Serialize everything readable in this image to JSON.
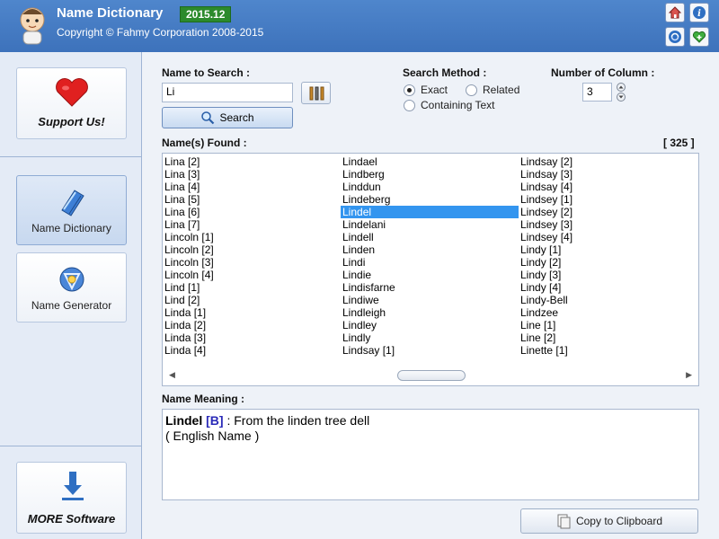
{
  "header": {
    "title": "Name Dictionary",
    "version": "2015.12",
    "copyright": "Copyright © Fahmy Corporation 2008-2015"
  },
  "sidebar": {
    "support_label": "Support Us!",
    "items": [
      {
        "label": "Name Dictionary",
        "active": true
      },
      {
        "label": "Name Generator",
        "active": false
      }
    ],
    "more_label": "MORE Software"
  },
  "search": {
    "label": "Name to Search :",
    "value": "Li",
    "button_label": "Search"
  },
  "method": {
    "label": "Search Method :",
    "options": [
      {
        "label": "Exact",
        "selected": true
      },
      {
        "label": "Related",
        "selected": false
      },
      {
        "label": "Containing Text",
        "selected": false
      }
    ]
  },
  "columns": {
    "label": "Number of Column :",
    "value": "3"
  },
  "results": {
    "label": "Name(s) Found :",
    "count": "[ 325 ]",
    "selected": "Lindel",
    "columns": [
      [
        "Lina [2]",
        "Lina [3]",
        "Lina [4]",
        "Lina [5]",
        "Lina [6]",
        "Lina [7]",
        "Lincoln [1]",
        "Lincoln [2]",
        "Lincoln [3]",
        "Lincoln [4]",
        "Lind [1]",
        "Lind [2]",
        "Linda [1]",
        "Linda [2]",
        "Linda [3]",
        "Linda [4]"
      ],
      [
        "Lindael",
        "Lindberg",
        "Linddun",
        "Lindeberg",
        "Lindel",
        "Lindelani",
        "Lindell",
        "Linden",
        "Lindi",
        "Lindie",
        "Lindisfarne",
        "Lindiwe",
        "Lindleigh",
        "Lindley",
        "Lindly",
        "Lindsay [1]"
      ],
      [
        "Lindsay [2]",
        "Lindsay [3]",
        "Lindsay [4]",
        "Lindsey [1]",
        "Lindsey [2]",
        "Lindsey [3]",
        "Lindsey [4]",
        "Lindy [1]",
        "Lindy [2]",
        "Lindy [3]",
        "Lindy [4]",
        "Lindy-Bell",
        "Lindzee",
        "Line [1]",
        "Line [2]",
        "Linette [1]"
      ]
    ]
  },
  "meaning": {
    "label": "Name Meaning :",
    "name": "Lindel",
    "gender": "[B]",
    "text": ": From the linden tree dell",
    "origin": "( English Name )"
  },
  "copy_button_label": "Copy to Clipboard",
  "colors": {
    "header": "#4f86cc",
    "selection": "#3395ef",
    "version_badge": "#2c8a2c",
    "gender_tag": "#2a2ab8"
  },
  "icons": [
    "home-icon",
    "info-icon",
    "refresh-icon",
    "favorite-icon",
    "heart-icon",
    "book-icon",
    "globe-icon",
    "download-icon",
    "search-icon",
    "tools-icon",
    "clipboard-icon"
  ]
}
